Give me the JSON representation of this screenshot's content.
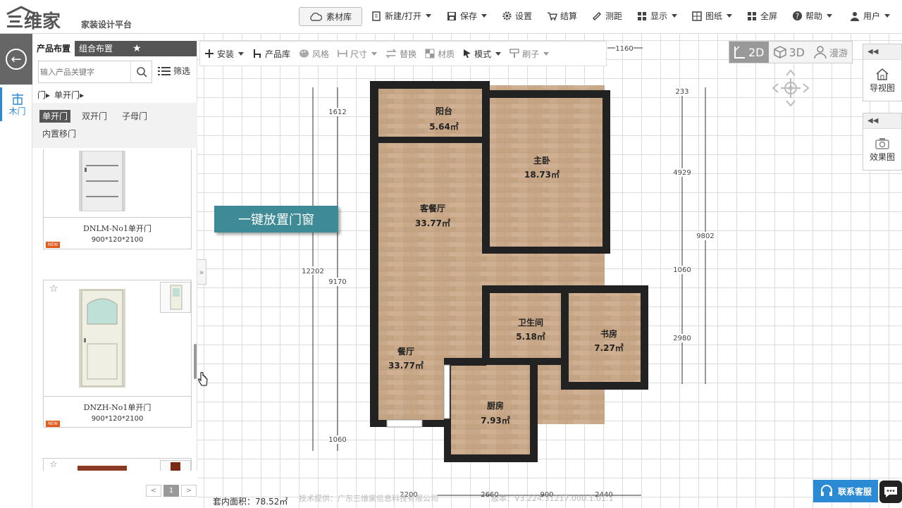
{
  "header": {
    "brand_tagline": "家装设计平台",
    "material_lib": "素材库",
    "menus": [
      {
        "label": "新建/打开",
        "icon": "document-icon"
      },
      {
        "label": "保存",
        "icon": "save-icon"
      },
      {
        "label": "设置",
        "icon": "gear-icon"
      },
      {
        "label": "结算",
        "icon": "cart-icon"
      },
      {
        "label": "测距",
        "icon": "ruler-icon"
      },
      {
        "label": "显示",
        "icon": "grid-icon"
      },
      {
        "label": "图纸",
        "icon": "drawing-icon"
      },
      {
        "label": "全屏",
        "icon": "fullscreen-icon"
      },
      {
        "label": "帮助",
        "icon": "help-icon"
      },
      {
        "label": "用户",
        "icon": "user-icon"
      }
    ]
  },
  "left_strip": {
    "category_label": "木门"
  },
  "panel": {
    "tabs": [
      "产品布置",
      "组合布置"
    ],
    "search_placeholder": "输入产品关键字",
    "filter_label": "筛选",
    "breadcrumb": [
      "门",
      "单开门"
    ],
    "subcategories": [
      "单开门",
      "双开门",
      "子母门",
      "内置移门"
    ],
    "products": [
      {
        "name": "DNLM-No1单开门",
        "dims": "900*120*2100",
        "badge": "NEW"
      },
      {
        "name": "DNZH-No1单开门",
        "dims": "900*120*2100",
        "badge": "NEW"
      }
    ],
    "pager": {
      "prev": "<",
      "current": "1",
      "next": ">"
    }
  },
  "toolbar": {
    "items": [
      {
        "label": "安装",
        "enabled": true,
        "dropdown": true
      },
      {
        "label": "产品库",
        "enabled": true,
        "dropdown": false
      },
      {
        "label": "风格",
        "enabled": false,
        "dropdown": false
      },
      {
        "label": "尺寸",
        "enabled": false,
        "dropdown": true
      },
      {
        "label": "替换",
        "enabled": false,
        "dropdown": false
      },
      {
        "label": "材质",
        "enabled": false,
        "dropdown": false
      },
      {
        "label": "模式",
        "enabled": true,
        "dropdown": true
      },
      {
        "label": "刷子",
        "enabled": false,
        "dropdown": true
      }
    ]
  },
  "view_switch": {
    "two_d": "2D",
    "three_d": "3D",
    "walk": "漫游"
  },
  "side_panels": {
    "nav_view": "导视图",
    "render": "效果图"
  },
  "banner": "一键放置门窗",
  "rooms": [
    {
      "name": "阳台",
      "area": "5.64㎡"
    },
    {
      "name": "主卧",
      "area": "18.73㎡"
    },
    {
      "name": "客餐厅",
      "area": "33.77㎡"
    },
    {
      "name": "卫生间",
      "area": "5.18㎡"
    },
    {
      "name": "书房",
      "area": "7.27㎡"
    },
    {
      "name": "餐厅",
      "area": "33.77㎡"
    },
    {
      "name": "厨房",
      "area": "7.93㎡"
    }
  ],
  "dimensions": {
    "top": "1160",
    "left_total": "12202",
    "left_sub": "9170",
    "left_top": "1612",
    "left_bottom": "1060",
    "right_top": "233",
    "right_a": "4929",
    "right_total": "9802",
    "right_b": "1060",
    "right_c": "2980",
    "bottom": [
      "2200",
      "2660",
      "900",
      "2440"
    ]
  },
  "footer": {
    "area": "套内面积：78.52㎡",
    "credit": "技术提供：广东三维家信息科技有限公司",
    "version": "版本：V3.224.31217.000.1.01.1",
    "support": "联系客服"
  }
}
